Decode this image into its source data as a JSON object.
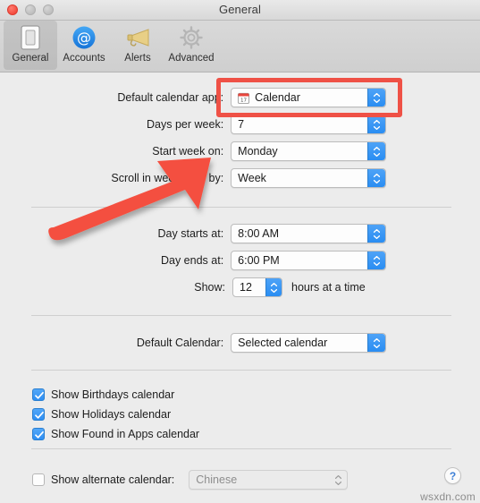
{
  "window": {
    "title": "General",
    "traffic_lights": [
      "close-button",
      "minimize-button",
      "zoom-button"
    ]
  },
  "toolbar": {
    "items": [
      {
        "label": "General",
        "icon": "general-icon",
        "selected": true
      },
      {
        "label": "Accounts",
        "icon": "accounts-icon",
        "selected": false
      },
      {
        "label": "Alerts",
        "icon": "alerts-icon",
        "selected": false
      },
      {
        "label": "Advanced",
        "icon": "advanced-icon",
        "selected": false
      }
    ]
  },
  "form": {
    "default_calendar_app": {
      "label": "Default calendar app:",
      "value": "Calendar",
      "icon": "calendar-app-icon"
    },
    "days_per_week": {
      "label": "Days per week:",
      "value": "7"
    },
    "start_week_on": {
      "label": "Start week on:",
      "value": "Monday"
    },
    "scroll_in_week_view_by": {
      "label": "Scroll in week view by:",
      "value": "Week"
    },
    "day_starts_at": {
      "label": "Day starts at:",
      "value": "8:00 AM"
    },
    "day_ends_at": {
      "label": "Day ends at:",
      "value": "6:00 PM"
    },
    "show_hours": {
      "label": "Show:",
      "value": "12",
      "suffix": "hours at a time"
    },
    "default_calendar": {
      "label": "Default Calendar:",
      "value": "Selected calendar"
    }
  },
  "checkboxes": [
    {
      "label": "Show Birthdays calendar",
      "checked": true
    },
    {
      "label": "Show Holidays calendar",
      "checked": true
    },
    {
      "label": "Show Found in Apps calendar",
      "checked": true
    }
  ],
  "alternate_calendar": {
    "label": "Show alternate calendar:",
    "checked": false,
    "value": "Chinese",
    "enabled": false
  },
  "help": {
    "label": "?"
  },
  "watermark": {
    "text": "wsxdn.com"
  },
  "annotation": {
    "highlight_color": "#ef5146",
    "arrow_color": "#f4503f",
    "target": "default-calendar-app-dropdown"
  },
  "colors": {
    "accent": "#2d8ef3",
    "window_bg": "#ececec",
    "toolbar_bg": "#d4d4d4",
    "text": "#1d1d1d"
  }
}
